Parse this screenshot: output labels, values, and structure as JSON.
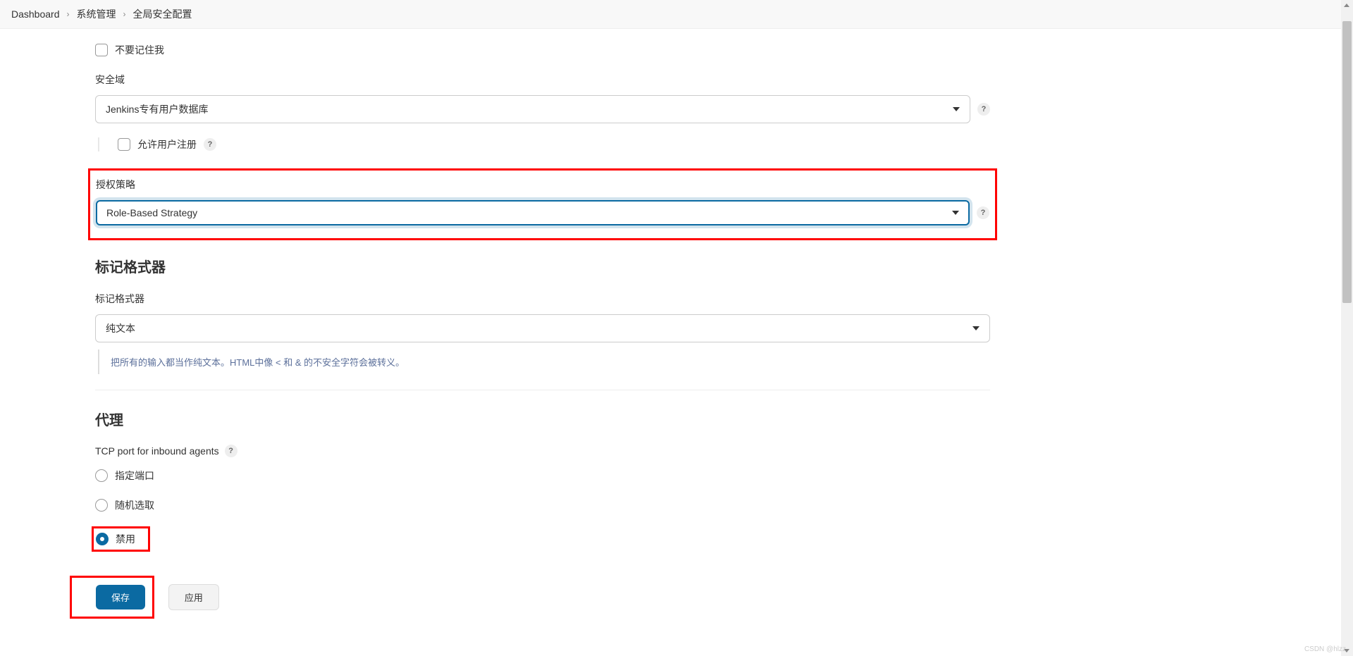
{
  "breadcrumb": {
    "items": [
      "Dashboard",
      "系统管理",
      "全局安全配置"
    ]
  },
  "remember_me": {
    "label": "不要记住我"
  },
  "security_realm": {
    "label": "安全域",
    "value": "Jenkins专有用户数据库",
    "allow_signup_label": "允许用户注册"
  },
  "authorization": {
    "label": "授权策略",
    "value": "Role-Based Strategy"
  },
  "markup": {
    "section_title": "标记格式器",
    "label": "标记格式器",
    "value": "纯文本",
    "help_text": "把所有的输入都当作纯文本。HTML中像 < 和 & 的不安全字符会被转义。"
  },
  "agent": {
    "section_title": "代理",
    "tcp_label": "TCP port for inbound agents",
    "options": {
      "fixed": "指定端口",
      "random": "随机选取",
      "disable": "禁用"
    }
  },
  "buttons": {
    "save": "保存",
    "apply": "应用"
  },
  "watermark": "CSDN @hlzz"
}
